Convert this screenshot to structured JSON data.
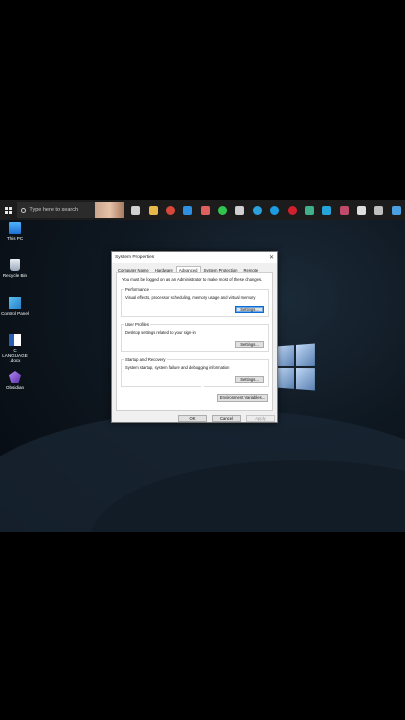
{
  "taskbar": {
    "search_placeholder": "Type here to search",
    "icons": [
      {
        "name": "task-view-icon",
        "color": "#d0d0d0"
      },
      {
        "name": "file-explorer-icon",
        "color": "#e8b84a"
      },
      {
        "name": "chrome-icon",
        "color": "#d7483b"
      },
      {
        "name": "vscode-icon",
        "color": "#2f8fe0"
      },
      {
        "name": "app-icon",
        "color": "#e06060"
      },
      {
        "name": "whatsapp-icon",
        "color": "#31c44f"
      },
      {
        "name": "app-icon",
        "color": "#cfcfcf"
      },
      {
        "name": "telegram-icon",
        "color": "#2aa0dd"
      },
      {
        "name": "skype-icon",
        "color": "#1d9be0"
      },
      {
        "name": "opera-icon",
        "color": "#d01f2f"
      },
      {
        "name": "app-icon",
        "color": "#3fb08a"
      },
      {
        "name": "maxthon-icon",
        "color": "#26a3d8"
      },
      {
        "name": "app-icon",
        "color": "#c04a6a"
      },
      {
        "name": "app-icon",
        "color": "#dddddd"
      },
      {
        "name": "app-icon",
        "color": "#bfbfbf"
      },
      {
        "name": "app-icon",
        "color": "#4aa0e0"
      }
    ]
  },
  "desktop": {
    "icons": [
      {
        "label": "This PC"
      },
      {
        "label": "Recycle Bin"
      },
      {
        "label": "Control Panel"
      },
      {
        "label": "C LANGUAGE .docx"
      },
      {
        "label": "Obsidian"
      }
    ]
  },
  "dialog": {
    "title": "System Properties",
    "tabs": [
      "Computer Name",
      "Hardware",
      "Advanced",
      "System Protection",
      "Remote"
    ],
    "active_tab": "Advanced",
    "notice": "You must be logged on as an Administrator to make most of these changes.",
    "performance": {
      "title": "Performance",
      "desc": "Visual effects, processor scheduling, memory usage and virtual memory",
      "button": "Settings..."
    },
    "user_profiles": {
      "title": "User Profiles",
      "desc": "Desktop settings related to your sign-in",
      "button": "Settings..."
    },
    "startup": {
      "title": "Startup and Recovery",
      "desc": "System startup, system failure and debugging information",
      "button": "Settings..."
    },
    "env_button": "Environment Variables...",
    "ok": "OK",
    "cancel": "Cancel",
    "apply": "Apply"
  }
}
